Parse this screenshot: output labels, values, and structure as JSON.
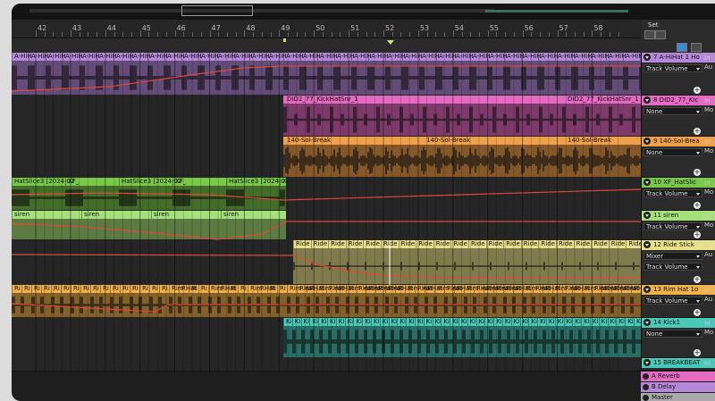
{
  "ruler": {
    "bars": [
      "42",
      "43",
      "44",
      "45",
      "46",
      "47",
      "48",
      "49",
      "50",
      "51",
      "52",
      "53",
      "54",
      "55",
      "56",
      "57",
      "58"
    ]
  },
  "set_panel": {
    "label": "Set"
  },
  "tracks": [
    {
      "id": "t7",
      "header": "7 A-HiHat 1 Ho",
      "color": "#b48ad8",
      "clip_label": "A-HiH",
      "device": "Track Volume",
      "io": [
        "In",
        "Au"
      ]
    },
    {
      "id": "t8",
      "header": "8 DID2_77_Kic",
      "color": "#e56ac2",
      "clip_label": "DID2_77_KickHatSnr_1",
      "clip_label_2": "DID2_77_KickHatSnr_1",
      "device": "None",
      "io": [
        "In",
        "Mo"
      ]
    },
    {
      "id": "t9",
      "header": "9 140-Sol-Brea",
      "color": "#f0a04a",
      "clip_label": "140-Sol-Break",
      "device": "None",
      "io": [
        "In",
        "Mo"
      ]
    },
    {
      "id": "t10",
      "header": "10 XF_HatSlic",
      "color": "#7ac84a",
      "clip_label": "HatSlice3 [2024-02",
      "clip_label_short": "XF_",
      "device": "Track Volume",
      "io": [
        "In",
        "Mo"
      ]
    },
    {
      "id": "t11",
      "header": "11 siren",
      "color": "#a6e07a",
      "clip_label": "siren",
      "device": "Track Volume",
      "io": [
        "In",
        "Mo"
      ]
    },
    {
      "id": "t12",
      "header": "12 Ride Stick",
      "color": "#e8e08a",
      "clip_label": "Ride",
      "device": "Mixer",
      "device_2": "Track Volume",
      "io": [
        "In",
        "Au"
      ]
    },
    {
      "id": "t13",
      "header": "13 Rim Hat 1o",
      "color": "#f0b04a",
      "clip_label": "Rim Hat",
      "clip_label_short": "Ri",
      "device": "Track Volume",
      "io": [
        "In",
        "Au"
      ]
    },
    {
      "id": "t14",
      "header": "14 Kick1",
      "color": "#4ac8b8",
      "clip_label": "Ki",
      "device": "None",
      "io": [
        "In",
        "Mo"
      ]
    },
    {
      "id": "t15",
      "header": "15 BREAKBEAT",
      "color": "#4ac8b8",
      "io": [
        "In"
      ]
    }
  ],
  "returns": [
    {
      "label": "A Reverb",
      "color": "#e56ac2",
      "letter": "A"
    },
    {
      "label": "B Delay",
      "color": "#b48ad8",
      "letter": "B"
    },
    {
      "label": "Master",
      "color": "#aaaaaa",
      "letter": ""
    }
  ],
  "colors": {
    "automation": "#e04a3a",
    "waveform": "#111111"
  }
}
